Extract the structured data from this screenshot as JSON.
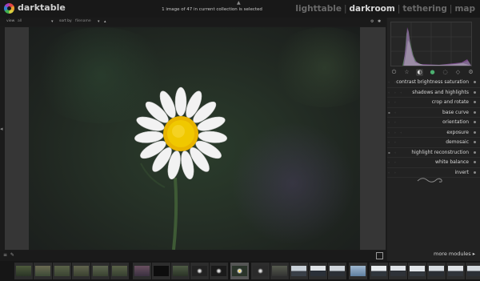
{
  "app": {
    "title": "darktable"
  },
  "header": {
    "collection_status": "1 image of 47 in current collection is selected",
    "views": [
      "lighttable",
      "darkroom",
      "tethering",
      "map"
    ],
    "active_view": "darkroom",
    "separator": "|"
  },
  "filterbar": {
    "view_label": "view",
    "view_value": "all",
    "sort_label": "sort by",
    "sort_value": "filename"
  },
  "right_panel": {
    "module_groups": [
      "active",
      "basic",
      "tone",
      "color",
      "correct",
      "effect"
    ],
    "modules": [
      "contrast brightness saturation",
      "shadows and highlights",
      "crop and rotate",
      "base curve",
      "orientation",
      "exposure",
      "demosaic",
      "highlight reconstruction",
      "white balance",
      "invert"
    ],
    "more_modules": "more modules"
  },
  "colors": {
    "background": "#1b1b1b",
    "panel": "#222222",
    "text": "#d8d8d8",
    "inactive_view": "#6a6a6a"
  },
  "filmstrip": {
    "thumbnail_count": 24,
    "selected_index": 11
  }
}
